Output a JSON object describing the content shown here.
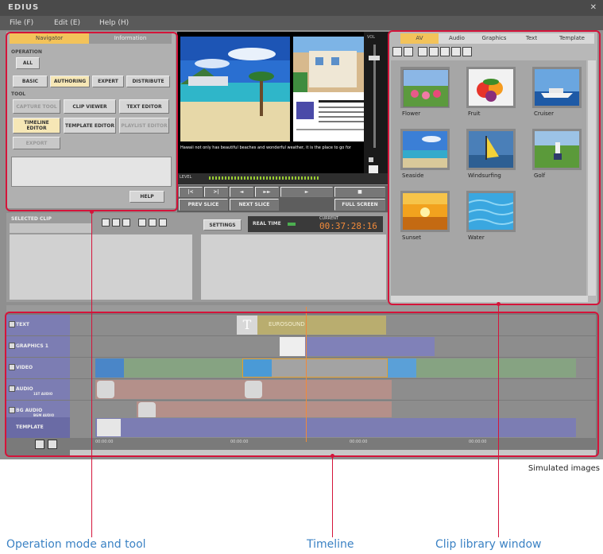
{
  "window": {
    "title": "EDIUS",
    "close_glyph": "✕"
  },
  "menu": {
    "items": [
      "File (F)",
      "Edit (E)",
      "Help (H)"
    ]
  },
  "left_panel": {
    "tabs": [
      "Navigator",
      "Information"
    ],
    "operation_label": "OPERATION",
    "tools_label": "TOOL",
    "buttons": {
      "all": "ALL",
      "basic": "BASIC",
      "authoring": "AUTHORING",
      "expert": "EXPERT",
      "distribute": "DISTRIBUTE",
      "capture": "CAPTURE TOOL",
      "clip_viewer": "CLIP VIEWER",
      "text_editor": "TEXT EDITOR",
      "timeline_editor": "TIMELINE EDITOR",
      "template_editor": "TEMPLATE EDITOR",
      "playlist_editor": "PLAYLIST EDITOR",
      "export": "EXPORT",
      "help": "HELP"
    }
  },
  "preview": {
    "caption": "Hawaii not only has beautiful beaches and wonderful weather, it is the place to go for",
    "vol_label": "VOL",
    "buttons": [
      "|<",
      ">|",
      "◄",
      "►►",
      "►",
      "■"
    ],
    "prev_slice": "PREV SLICE",
    "next_slice": "NEXT SLICE",
    "full_screen": "FULL SCREEN",
    "level_label": "LEVEL"
  },
  "clip_section": {
    "selected_clip": "SELECTED CLIP",
    "settings": "SETTINGS",
    "real_time": "REAL TIME",
    "current_label": "CURRENT",
    "current_time": "00:37:28:16"
  },
  "library": {
    "tabs": [
      "AV",
      "Audio",
      "Graphics",
      "Text",
      "Template"
    ],
    "items": [
      {
        "name": "Flower"
      },
      {
        "name": "Fruit"
      },
      {
        "name": "Cruiser"
      },
      {
        "name": "Seaside"
      },
      {
        "name": "Windsurfing"
      },
      {
        "name": "Golf"
      },
      {
        "name": "Sunset"
      },
      {
        "name": "Water"
      }
    ]
  },
  "timeline": {
    "tracks": [
      "TEXT",
      "GRAPHICS 1",
      "VIDEO",
      "AUDIO",
      "BG AUDIO",
      "TEMPLATE"
    ],
    "sublabels": [
      "",
      "",
      "",
      "1ST AUDIO",
      "BGM AUDIO",
      ""
    ],
    "text_clip_label": "EUROSOUND",
    "text_clip_glyph": "T",
    "ruler": [
      "00:00:00",
      "00:00:00",
      "00:00:00",
      "00:00:00"
    ]
  },
  "annotations": {
    "simulated": "Simulated images",
    "operation": "Operation mode and tool",
    "timeline": "Timeline",
    "library": "Clip library window"
  },
  "colors": {
    "highlight": "#d4143a",
    "callout_text": "#3b82c4"
  }
}
